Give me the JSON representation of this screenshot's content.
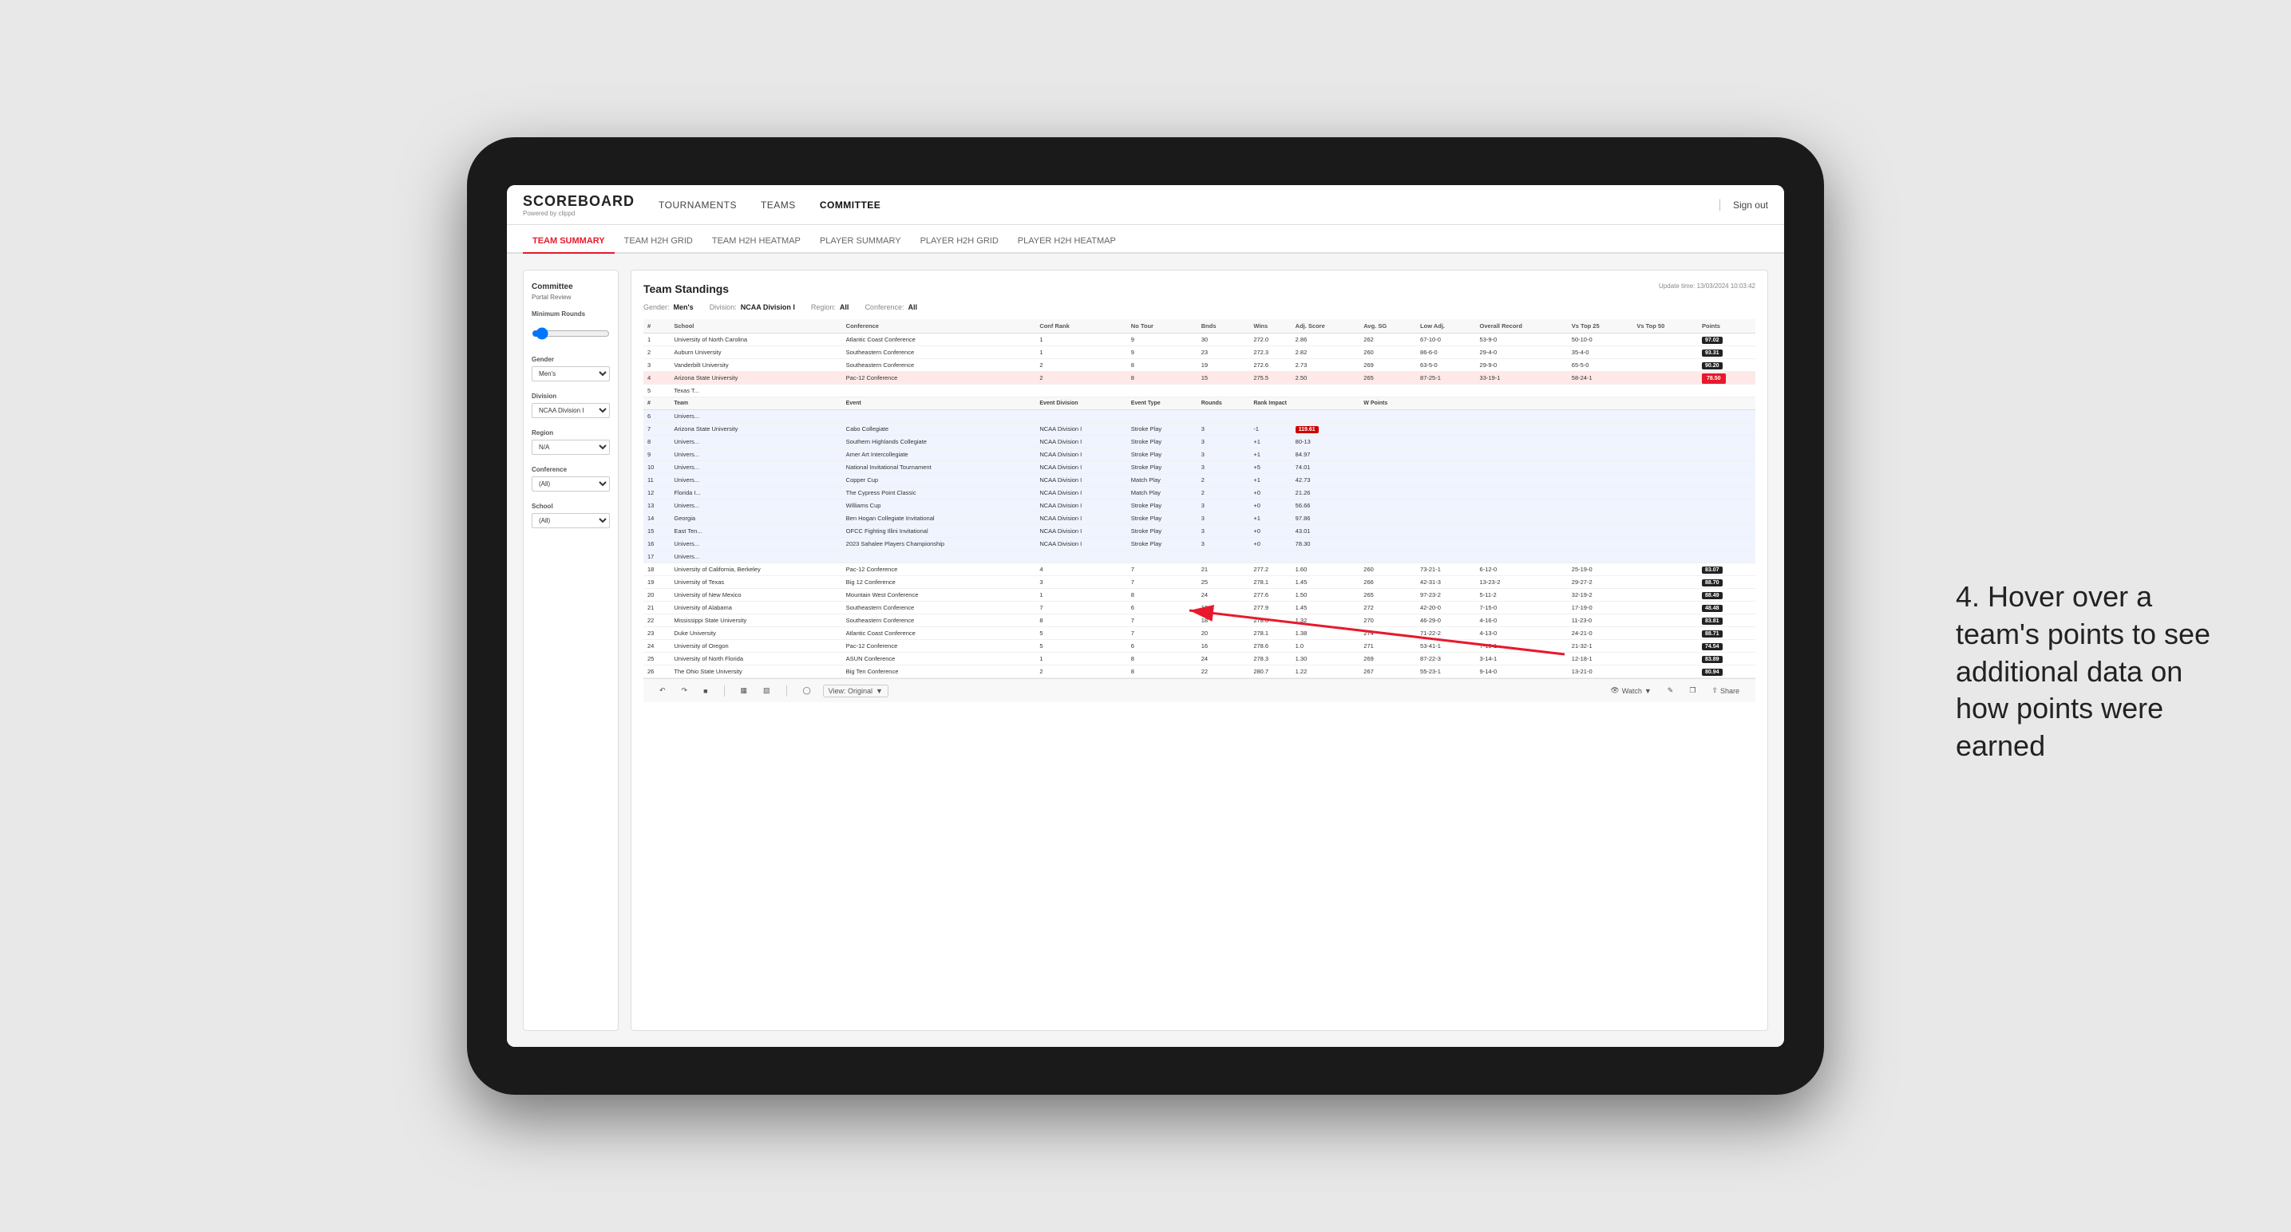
{
  "app": {
    "logo": "SCOREBOARD",
    "logo_sub": "Powered by clippd",
    "sign_out_sep": "|",
    "sign_out": "Sign out"
  },
  "top_nav": {
    "items": [
      {
        "label": "TOURNAMENTS",
        "active": false
      },
      {
        "label": "TEAMS",
        "active": false
      },
      {
        "label": "COMMITTEE",
        "active": true
      }
    ]
  },
  "sub_nav": {
    "items": [
      {
        "label": "TEAM SUMMARY",
        "active": true
      },
      {
        "label": "TEAM H2H GRID",
        "active": false
      },
      {
        "label": "TEAM H2H HEATMAP",
        "active": false
      },
      {
        "label": "PLAYER SUMMARY",
        "active": false
      },
      {
        "label": "PLAYER H2H GRID",
        "active": false
      },
      {
        "label": "PLAYER H2H HEATMAP",
        "active": false
      }
    ]
  },
  "sidebar": {
    "title": "Committee",
    "subtitle": "Portal Review",
    "sections": [
      {
        "label": "Minimum Rounds",
        "type": "range",
        "value": "0"
      },
      {
        "label": "Gender",
        "type": "select",
        "value": "Men's"
      },
      {
        "label": "Division",
        "type": "select",
        "value": "NCAA Division I"
      },
      {
        "label": "Region",
        "type": "select",
        "value": "N/A"
      },
      {
        "label": "Conference",
        "type": "select",
        "value": "(All)"
      },
      {
        "label": "School",
        "type": "select",
        "value": "(All)"
      }
    ]
  },
  "table": {
    "title": "Team Standings",
    "update_time": "Update time: 13/03/2024 10:03:42",
    "filters": {
      "gender_label": "Gender:",
      "gender_value": "Men's",
      "division_label": "Division:",
      "division_value": "NCAA Division I",
      "region_label": "Region:",
      "region_value": "All",
      "conference_label": "Conference:",
      "conference_value": "All"
    },
    "columns": [
      "#",
      "School",
      "Conference",
      "Conf Rank",
      "No Tour",
      "Bnds",
      "Wins",
      "Adj. Score",
      "Avg. SG",
      "Low Adj.",
      "Overall Record",
      "Vs Top 25",
      "Vs Top 50",
      "Points"
    ],
    "rows": [
      {
        "rank": 1,
        "school": "University of North Carolina",
        "conf": "Atlantic Coast Conference",
        "confRank": 1,
        "tours": 9,
        "bnds": 30,
        "wins": 272.0,
        "avgScore": 2.86,
        "adjScore": 262,
        "lowAdj": "67-10-0",
        "overallRec": "53-9-0",
        "vsTop25": "50-10-0",
        "vsTop50": "97.02",
        "points": "97.02",
        "highlight": false
      },
      {
        "rank": 2,
        "school": "Auburn University",
        "conf": "Southeastern Conference",
        "confRank": 1,
        "tours": 9,
        "bnds": 23,
        "wins": 272.3,
        "avgScore": 2.82,
        "adjScore": 260,
        "lowAdj": "86-6-0",
        "overallRec": "29-4-0",
        "vsTop25": "35-4-0",
        "vsTop50": "93.31",
        "points": "93.31",
        "highlight": false
      },
      {
        "rank": 3,
        "school": "Vanderbilt University",
        "conf": "Southeastern Conference",
        "confRank": 2,
        "tours": 8,
        "bnds": 19,
        "wins": 272.6,
        "avgScore": 2.73,
        "adjScore": 269,
        "lowAdj": "63-5-0",
        "overallRec": "29-9-0",
        "vsTop25": "65-5-0",
        "vsTop50": "90.20",
        "points": "90.20",
        "highlight": false
      },
      {
        "rank": 4,
        "school": "Arizona State University",
        "conf": "Pac-12 Conference",
        "confRank": 2,
        "tours": 8,
        "bnds": 15,
        "wins": 275.5,
        "avgScore": 2.5,
        "adjScore": 265,
        "lowAdj": "87-25-1",
        "overallRec": "33-19-1",
        "vsTop25": "58-24-1",
        "vsTop50": "78.50",
        "points": "78.50",
        "highlight": true
      },
      {
        "rank": 5,
        "school": "Texas T...",
        "conf": "",
        "confRank": "",
        "tours": "",
        "bnds": "",
        "wins": "",
        "avgScore": "",
        "adjScore": "",
        "lowAdj": "",
        "overallRec": "",
        "vsTop25": "",
        "vsTop50": "",
        "points": "",
        "highlight": false
      }
    ],
    "expanded_section": {
      "visible": true,
      "sub_columns": [
        "#",
        "Team",
        "Event",
        "Event Division",
        "Event Type",
        "Rounds",
        "Rank Impact",
        "W Points"
      ],
      "rows": [
        {
          "rank": 6,
          "team": "Univers...",
          "event": "",
          "division": "",
          "type": "",
          "rounds": "",
          "rankImpact": "",
          "points": ""
        },
        {
          "rank": 7,
          "team": "Univers...",
          "event": "Cabo Collegiate",
          "division": "NCAA Division I",
          "type": "Stroke Play",
          "rounds": 3,
          "rankImpact": -1,
          "points": "119.61"
        },
        {
          "rank": 8,
          "team": "Univers...",
          "event": "Southern Highlands Collegiate",
          "division": "NCAA Division I",
          "type": "Stroke Play",
          "rounds": 3,
          "rankImpact": 1,
          "points": "80-13"
        },
        {
          "rank": 9,
          "team": "Univers...",
          "event": "Amer Art Intercollegiate",
          "division": "NCAA Division I",
          "type": "Stroke Play",
          "rounds": 3,
          "rankImpact": 1,
          "points": "84.97"
        },
        {
          "rank": 10,
          "team": "Univers...",
          "event": "National Invitational Tournament",
          "division": "NCAA Division I",
          "type": "Stroke Play",
          "rounds": 3,
          "rankImpact": 5,
          "points": "74.01"
        },
        {
          "rank": 11,
          "team": "Univers...",
          "event": "Copper Cup",
          "division": "NCAA Division I",
          "type": "Match Play",
          "rounds": 2,
          "rankImpact": 1,
          "points": "42.73"
        },
        {
          "rank": 12,
          "team": "Florida I...",
          "event": "The Cypress Point Classic",
          "division": "NCAA Division I",
          "type": "Match Play",
          "rounds": 2,
          "rankImpact": 0,
          "points": "21.26"
        },
        {
          "rank": 13,
          "team": "Univers...",
          "event": "Williams Cup",
          "division": "NCAA Division I",
          "type": "Stroke Play",
          "rounds": 3,
          "rankImpact": 0,
          "points": "56.66"
        },
        {
          "rank": 14,
          "team": "Georgia",
          "event": "Ben Hogan Collegiate Invitational",
          "division": "NCAA Division I",
          "type": "Stroke Play",
          "rounds": 3,
          "rankImpact": 1,
          "points": "97.86"
        },
        {
          "rank": 15,
          "team": "East Ter...",
          "event": "OFCC Fighting Illini Invitational",
          "division": "NCAA Division I",
          "type": "Stroke Play",
          "rounds": 3,
          "rankImpact": 0,
          "points": "43.01"
        },
        {
          "rank": 16,
          "team": "Univers...",
          "event": "2023 Sahalee Players Championship",
          "division": "NCAA Division I",
          "type": "Stroke Play",
          "rounds": 3,
          "rankImpact": 0,
          "points": "78.30"
        },
        {
          "rank": 17,
          "team": "Univers...",
          "event": "",
          "division": "",
          "type": "",
          "rounds": "",
          "rankImpact": "",
          "points": ""
        }
      ]
    },
    "bottom_rows": [
      {
        "rank": 18,
        "school": "University of California, Berkeley",
        "conf": "Pac-12 Conference",
        "confRank": 4,
        "tours": 7,
        "bnds": 21,
        "wins": 277.2,
        "avgScore": 1.6,
        "adjScore": 260,
        "lowAdj": "73-21-1",
        "overallRec": "6-12-0",
        "vsTop25": "25-19-0",
        "vsTop50": "83.07"
      },
      {
        "rank": 19,
        "school": "University of Texas",
        "conf": "Big 12 Conference",
        "confRank": 3,
        "tours": 7,
        "bnds": 25,
        "wins": 278.1,
        "avgScore": 1.45,
        "adjScore": 266,
        "lowAdj": "42-31-3",
        "overallRec": "13-23-2",
        "vsTop25": "29-27-2",
        "vsTop50": "88.70"
      },
      {
        "rank": 20,
        "school": "University of New Mexico",
        "conf": "Mountain West Conference",
        "confRank": 1,
        "tours": 8,
        "bnds": 24,
        "wins": 277.6,
        "avgScore": 1.5,
        "adjScore": 265,
        "lowAdj": "97-23-2",
        "overallRec": "5-11-2",
        "vsTop25": "32-19-2",
        "vsTop50": "88.49"
      },
      {
        "rank": 21,
        "school": "University of Alabama",
        "conf": "Southeastern Conference",
        "confRank": 7,
        "tours": 6,
        "bnds": 13,
        "wins": 277.9,
        "avgScore": 1.45,
        "adjScore": 272,
        "lowAdj": "42-20-0",
        "overallRec": "7-15-0",
        "vsTop25": "17-19-0",
        "vsTop50": "48.48"
      },
      {
        "rank": 22,
        "school": "Mississippi State University",
        "conf": "Southeastern Conference",
        "confRank": 8,
        "tours": 7,
        "bnds": 18,
        "wins": 278.6,
        "avgScore": 1.32,
        "adjScore": 270,
        "lowAdj": "46-29-0",
        "overallRec": "4-16-0",
        "vsTop25": "11-23-0",
        "vsTop50": "83.81"
      },
      {
        "rank": 23,
        "school": "Duke University",
        "conf": "Atlantic Coast Conference",
        "confRank": 5,
        "tours": 7,
        "bnds": 20,
        "wins": 278.1,
        "avgScore": 1.38,
        "adjScore": 274,
        "lowAdj": "71-22-2",
        "overallRec": "4-13-0",
        "vsTop25": "24-21-0",
        "vsTop50": "88.71"
      },
      {
        "rank": 24,
        "school": "University of Oregon",
        "conf": "Pac-12 Conference",
        "confRank": 5,
        "tours": 6,
        "bnds": 16,
        "wins": 278.6,
        "avgScore": 1.0,
        "adjScore": 271,
        "lowAdj": "53-41-1",
        "overallRec": "7-19-1",
        "vsTop25": "21-32-1",
        "vsTop50": "74.54"
      },
      {
        "rank": 25,
        "school": "University of North Florida",
        "conf": "ASUN Conference",
        "confRank": 1,
        "tours": 8,
        "bnds": 24,
        "wins": 278.3,
        "avgScore": 1.3,
        "adjScore": 269,
        "lowAdj": "87-22-3",
        "overallRec": "3-14-1",
        "vsTop25": "12-18-1",
        "vsTop50": "83.89"
      },
      {
        "rank": 26,
        "school": "The Ohio State University",
        "conf": "Big Ten Conference",
        "confRank": 2,
        "tours": 8,
        "bnds": 22,
        "wins": 280.7,
        "avgScore": 1.22,
        "adjScore": 267,
        "lowAdj": "55-23-1",
        "overallRec": "9-14-0",
        "vsTop25": "13-21-0",
        "vsTop50": "80.94"
      }
    ]
  },
  "toolbar": {
    "view_label": "View: Original",
    "watch_label": "Watch",
    "share_label": "Share"
  },
  "annotation": {
    "text": "4. Hover over a team's points to see additional data on how points were earned"
  }
}
